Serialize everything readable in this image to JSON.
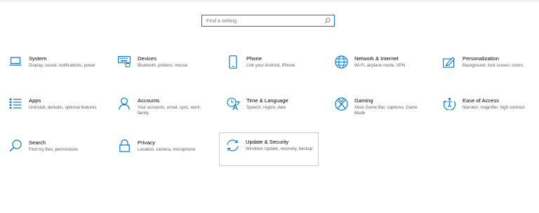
{
  "search": {
    "placeholder": "Find a setting"
  },
  "accent": "#0078d7",
  "tiles": [
    {
      "title": "System",
      "desc": "Display, sound, notifications, power",
      "icon": "laptop-icon"
    },
    {
      "title": "Devices",
      "desc": "Bluetooth, printers, mouse",
      "icon": "keyboard-icon"
    },
    {
      "title": "Phone",
      "desc": "Link your Android, iPhone",
      "icon": "phone-icon"
    },
    {
      "title": "Network & Internet",
      "desc": "Wi-Fi, airplane mode, VPN",
      "icon": "globe-icon"
    },
    {
      "title": "Personalization",
      "desc": "Background, lock screen, colors",
      "icon": "paint-icon"
    },
    {
      "title": "Apps",
      "desc": "Uninstall, defaults, optional features",
      "icon": "apps-list-icon"
    },
    {
      "title": "Accounts",
      "desc": "Your accounts, email, sync, work, family",
      "icon": "person-icon"
    },
    {
      "title": "Time & Language",
      "desc": "Speech, region, date",
      "icon": "time-language-icon"
    },
    {
      "title": "Gaming",
      "desc": "Xbox Game Bar, captures, Game Mode",
      "icon": "xbox-icon"
    },
    {
      "title": "Ease of Access",
      "desc": "Narrator, magnifier, high contrast",
      "icon": "ease-of-access-icon"
    },
    {
      "title": "Search",
      "desc": "Find my files, permissions",
      "icon": "magnifier-icon"
    },
    {
      "title": "Privacy",
      "desc": "Location, camera, microphone",
      "icon": "lock-icon"
    },
    {
      "title": "Update & Security",
      "desc": "Windows Update, recovery, backup",
      "icon": "sync-icon"
    }
  ]
}
